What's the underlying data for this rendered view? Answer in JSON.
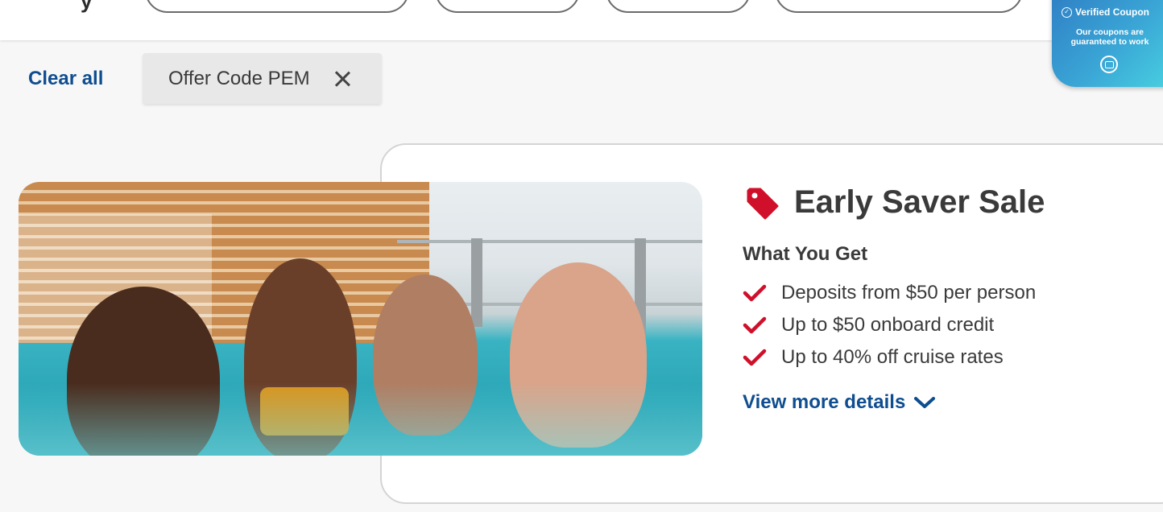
{
  "coupon_badge": {
    "title": "Verified Coupon",
    "subtitle": "Our coupons are guaranteed to work"
  },
  "filters": {
    "clear_all": "Clear all",
    "active_chip": "Offer Code PEM"
  },
  "offer": {
    "title": "Early Saver Sale",
    "section_heading": "What You Get",
    "benefits": [
      "Deposits from $50 per person",
      "Up to $50 onboard credit",
      "Up to 40% off cruise rates"
    ],
    "details_link": "View more details"
  },
  "colors": {
    "link_blue": "#0e4d8f",
    "accent_red": "#d0102a",
    "text_dark": "#3a3a3a"
  },
  "icons": {
    "chip_remove": "close-icon",
    "offer": "price-tag-icon",
    "benefit": "checkmark-icon",
    "details": "chevron-down-icon"
  }
}
